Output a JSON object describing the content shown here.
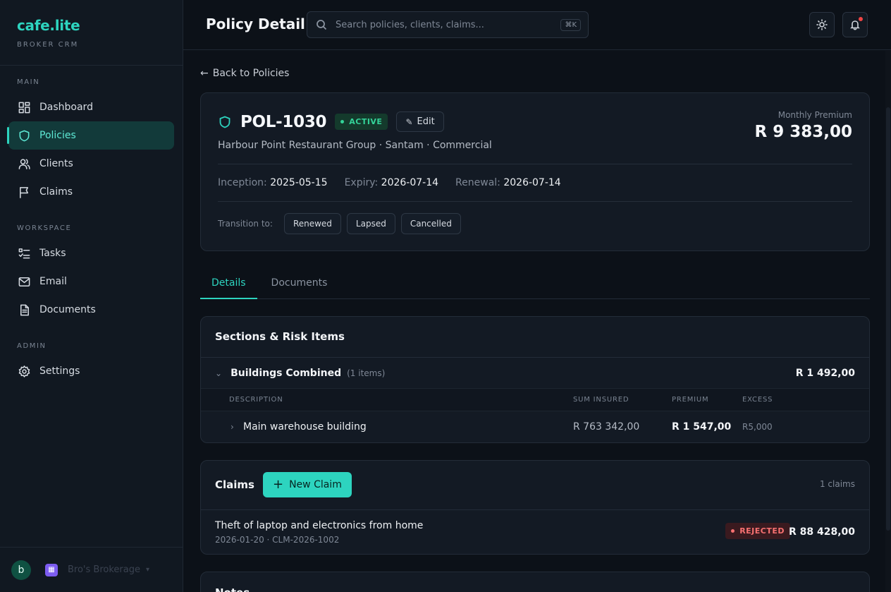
{
  "brand": {
    "name": "cafe.lite",
    "subtitle": "BROKER CRM"
  },
  "sidebar": {
    "sections": [
      {
        "heading": "MAIN",
        "items": [
          {
            "label": "Dashboard",
            "icon": "dashboard-icon"
          },
          {
            "label": "Policies",
            "icon": "shield-icon",
            "active": true
          },
          {
            "label": "Clients",
            "icon": "users-icon"
          },
          {
            "label": "Claims",
            "icon": "flag-icon"
          }
        ]
      },
      {
        "heading": "WORKSPACE",
        "items": [
          {
            "label": "Tasks",
            "icon": "tasks-icon"
          },
          {
            "label": "Email",
            "icon": "mail-icon"
          },
          {
            "label": "Documents",
            "icon": "document-icon"
          }
        ]
      },
      {
        "heading": "ADMIN",
        "items": [
          {
            "label": "Settings",
            "icon": "gear-icon"
          }
        ]
      }
    ],
    "footer": {
      "avatar_letter": "b",
      "org_name": "Bro's Brokerage"
    }
  },
  "topbar": {
    "title": "Policy Detail",
    "search_placeholder": "Search policies, clients, claims...",
    "search_shortcut": "⌘K"
  },
  "back_link": "Back to Policies",
  "policy": {
    "id": "POL-1030",
    "status": "ACTIVE",
    "edit_label": "Edit",
    "subtitle": "Harbour Point Restaurant Group · Santam · Commercial",
    "premium_label": "Monthly Premium",
    "premium_value": "R 9 383,00",
    "inception_label": "Inception:",
    "inception": "2025-05-15",
    "expiry_label": "Expiry:",
    "expiry": "2026-07-14",
    "renewal_label": "Renewal:",
    "renewal": "2026-07-14",
    "transition_label": "Transition to:",
    "transitions": [
      "Renewed",
      "Lapsed",
      "Cancelled"
    ]
  },
  "tabs": [
    "Details",
    "Documents"
  ],
  "sections_card": {
    "title": "Sections & Risk Items",
    "section": {
      "name": "Buildings Combined",
      "count": "(1 items)",
      "amount": "R 1 492,00"
    },
    "columns": [
      "DESCRIPTION",
      "SUM INSURED",
      "PREMIUM",
      "EXCESS"
    ],
    "rows": [
      {
        "description": "Main warehouse building",
        "sum_insured": "R 763 342,00",
        "premium": "R 1 547,00",
        "excess": "R5,000"
      }
    ]
  },
  "claims_card": {
    "title": "Claims",
    "new_label": "New Claim",
    "count": "1 claims",
    "items": [
      {
        "title": "Theft of laptop and electronics from home",
        "meta": "2026-01-20 · CLM-2026-1002",
        "status": "REJECTED",
        "amount": "R 88 428,00"
      }
    ]
  },
  "notes_card": {
    "title": "Notes"
  },
  "colors": {
    "accent": "#2dd4bf",
    "background": "#0c1118",
    "card": "#131a24",
    "active_status": "#34d399",
    "rejected_status": "#f87171",
    "notification": "#ef4444"
  }
}
